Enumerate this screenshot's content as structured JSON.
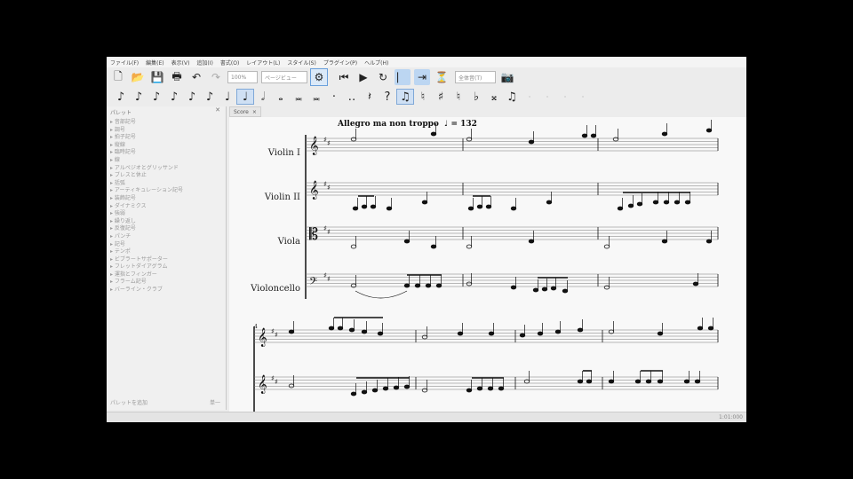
{
  "menu": [
    "ファイル(F)",
    "編集(E)",
    "表示(V)",
    "追加(I)",
    "書式(O)",
    "レイアウト(L)",
    "スタイル(S)",
    "プラグイン(P)",
    "ヘルプ(H)"
  ],
  "toolbar": {
    "zoom_value": "100%",
    "view_mode": "ページビュー",
    "metronome_label": "全体音(T)"
  },
  "palette": {
    "title": "パレット",
    "items": [
      "音部記号",
      "調号",
      "拍子記号",
      "縦線",
      "臨時記号",
      "線",
      "アルペジオとグリッサンド",
      "ブレスと休止",
      "括弧",
      "アーティキュレーション記号",
      "装飾記号",
      "ダイナミクス",
      "強弱",
      "繰り返し",
      "反復記号",
      "パンチ",
      "記号",
      "テンポ",
      "ビブラートサポーター",
      "フレットダイアグラム",
      "運指とフィンガー",
      "フラーム記号",
      "バーライン・クラブ"
    ],
    "footer": "パレットを追加",
    "footer_right": "単一"
  },
  "score_tab": "Score",
  "score": {
    "tempo_text": "Allegro ma non troppo",
    "tempo_value": "= 132",
    "instruments": [
      "Violin I",
      "Violin II",
      "Viola",
      "Violoncello"
    ],
    "system2_measure_number": "4"
  },
  "status_text": "1:01:000"
}
